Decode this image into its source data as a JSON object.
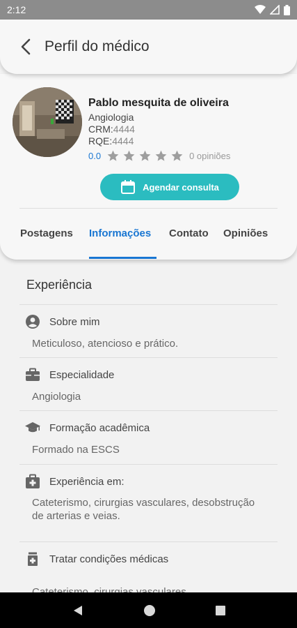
{
  "status_bar": {
    "time": "2:12"
  },
  "header": {
    "title": "Perfil do médico"
  },
  "doctor": {
    "name": "Pablo mesquita de oliveira",
    "specialty": "Angiologia",
    "crm_label": "CRM:",
    "crm_value": "4444",
    "rqe_label": "RQE:",
    "rqe_value": "4444",
    "rating": "0.0",
    "stars_filled": 0,
    "stars_total": 5,
    "reviews_label": "0 opiniões"
  },
  "book_button": {
    "label": "Agendar consulta"
  },
  "tabs": [
    {
      "label": "Postagens"
    },
    {
      "label": "Informações"
    },
    {
      "label": "Contato"
    },
    {
      "label": "Opiniões"
    }
  ],
  "active_tab": "Informações",
  "info": {
    "section_title": "Experiência",
    "items": [
      {
        "icon": "user-circle-icon",
        "title": "Sobre mim",
        "text": "Meticuloso, atencioso e prático."
      },
      {
        "icon": "briefcase-icon",
        "title": "Especialidade",
        "text": "Angiologia"
      },
      {
        "icon": "graduation-cap-icon",
        "title": "Formação acadêmica",
        "text": "Formado na ESCS"
      },
      {
        "icon": "medical-kit-icon",
        "title": "Experiência em:",
        "text": "Cateterismo, cirurgias vasculares, desobstrução de arterias e veias."
      },
      {
        "icon": "medicine-bottle-icon",
        "title": "Tratar condições médicas",
        "text": "Cateterismo, cirurgias vasculares"
      }
    ]
  },
  "colors": {
    "accent": "#1976d2",
    "button": "#2bbcc0",
    "status_bar": "#8c8c8c"
  }
}
